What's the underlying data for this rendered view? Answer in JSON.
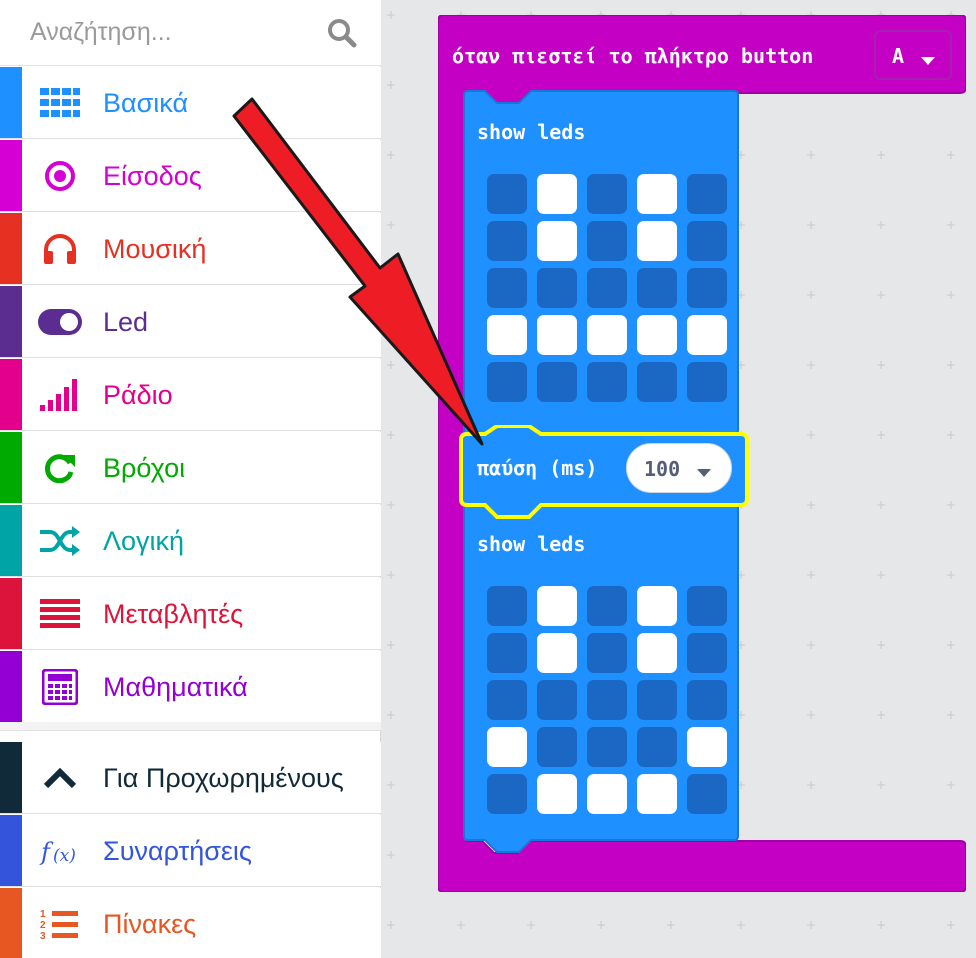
{
  "search": {
    "placeholder": "Αναζήτηση...",
    "icon": "search-icon"
  },
  "categories": [
    {
      "label": "Βασικά",
      "color": "#1e90ff",
      "icon": "grid-icon"
    },
    {
      "label": "Είσοδος",
      "color": "#d400d4",
      "icon": "target-icon"
    },
    {
      "label": "Μουσική",
      "color": "#e63022",
      "icon": "headphones-icon"
    },
    {
      "label": "Led",
      "color": "#5c2d91",
      "icon": "toggle-icon"
    },
    {
      "label": "Ράδιο",
      "color": "#e3008c",
      "icon": "signal-bars-icon"
    },
    {
      "label": "Βρόχοι",
      "color": "#00aa00",
      "icon": "refresh-icon"
    },
    {
      "label": "Λογική",
      "color": "#00a4a6",
      "icon": "shuffle-icon"
    },
    {
      "label": "Μεταβλητές",
      "color": "#dc143c",
      "icon": "lines-icon"
    },
    {
      "label": "Μαθηματικά",
      "color": "#9400d3",
      "icon": "calculator-icon"
    }
  ],
  "advanced": [
    {
      "label": "Για Προχωρημένους",
      "color": "#102a3a",
      "icon": "chevron-up-icon"
    },
    {
      "label": "Συναρτήσεις",
      "color": "#3455db",
      "icon": "function-icon"
    },
    {
      "label": "Πίνακες",
      "color": "#e65722",
      "icon": "numbered-list-icon"
    }
  ],
  "event_block": {
    "label": "όταν πιεστεί το πλήκτρο button",
    "button_value": "A",
    "color": "#c500c5"
  },
  "show_leds_1": {
    "label": "show leds",
    "grid": [
      [
        0,
        1,
        0,
        1,
        0
      ],
      [
        0,
        1,
        0,
        1,
        0
      ],
      [
        0,
        0,
        0,
        0,
        0
      ],
      [
        1,
        1,
        1,
        1,
        1
      ],
      [
        0,
        0,
        0,
        0,
        0
      ]
    ]
  },
  "pause_block": {
    "label": "παύση (ms)",
    "value": "100",
    "highlight_color": "#ffff00"
  },
  "show_leds_2": {
    "label": "show leds",
    "grid": [
      [
        0,
        1,
        0,
        1,
        0
      ],
      [
        0,
        1,
        0,
        1,
        0
      ],
      [
        0,
        0,
        0,
        0,
        0
      ],
      [
        1,
        0,
        0,
        0,
        1
      ],
      [
        0,
        1,
        1,
        1,
        0
      ]
    ]
  },
  "colors": {
    "basic_block": "#1e90ff",
    "led_off": "#1a68c4",
    "led_on": "#ffffff",
    "annotation_arrow": "#ee1c24"
  }
}
